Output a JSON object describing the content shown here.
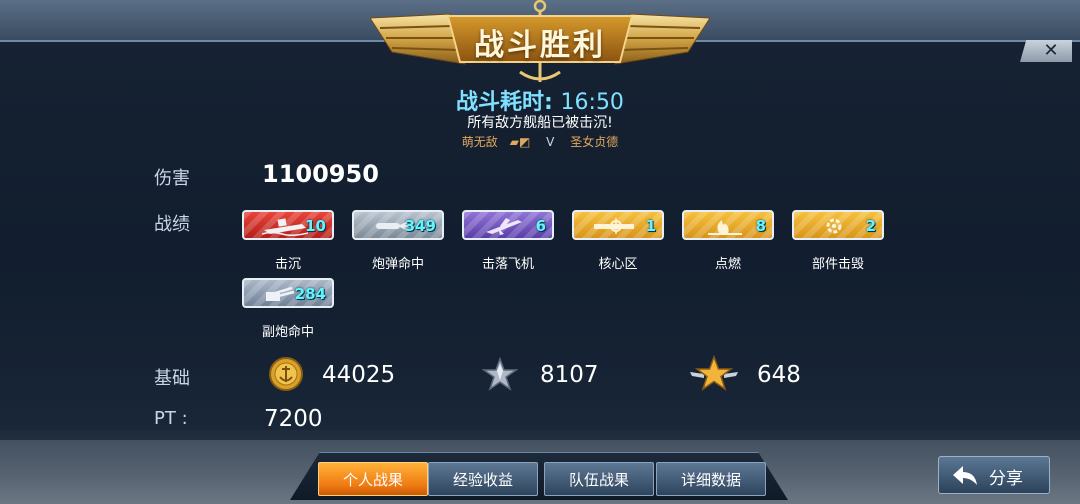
{
  "header": {
    "title": "战斗胜利",
    "battle_time_label": "战斗耗时:",
    "battle_time_value": "16:50",
    "result_message": "所有敌方舰船已被击沉!",
    "player_left": "萌无敌",
    "vs": "V",
    "player_right": "圣女贞德",
    "close_label": "✕"
  },
  "damage": {
    "label": "伤害",
    "value": "1100950"
  },
  "record": {
    "label": "战绩",
    "badges": [
      {
        "label": "击沉",
        "count": "10",
        "color": "#d8302a",
        "icon": "sinking-ship-icon"
      },
      {
        "label": "炮弹命中",
        "count": "349",
        "color": "#9aa6b3",
        "icon": "shell-hit-icon"
      },
      {
        "label": "击落飞机",
        "count": "6",
        "color": "#7356c2",
        "icon": "plane-shotdown-icon"
      },
      {
        "label": "核心区",
        "count": "1",
        "color": "#e8a824",
        "icon": "core-zone-icon"
      },
      {
        "label": "点燃",
        "count": "8",
        "color": "#e8a824",
        "icon": "fire-icon"
      },
      {
        "label": "部件击毁",
        "count": "2",
        "color": "#e8a824",
        "icon": "gear-destroyed-icon"
      },
      {
        "label": "副炮命中",
        "count": "284",
        "color": "#8b9bb0",
        "icon": "secondary-gun-icon"
      }
    ]
  },
  "basic": {
    "label": "基础",
    "gold": "44025",
    "silver_star": "8107",
    "gold_star": "648"
  },
  "pt": {
    "label": "PT :",
    "value": "7200"
  },
  "tabs": [
    {
      "label": "个人战果",
      "active": true
    },
    {
      "label": "经验收益",
      "active": false
    },
    {
      "label": "队伍战果",
      "active": false
    },
    {
      "label": "详细数据",
      "active": false
    }
  ],
  "share": {
    "label": "分享"
  }
}
